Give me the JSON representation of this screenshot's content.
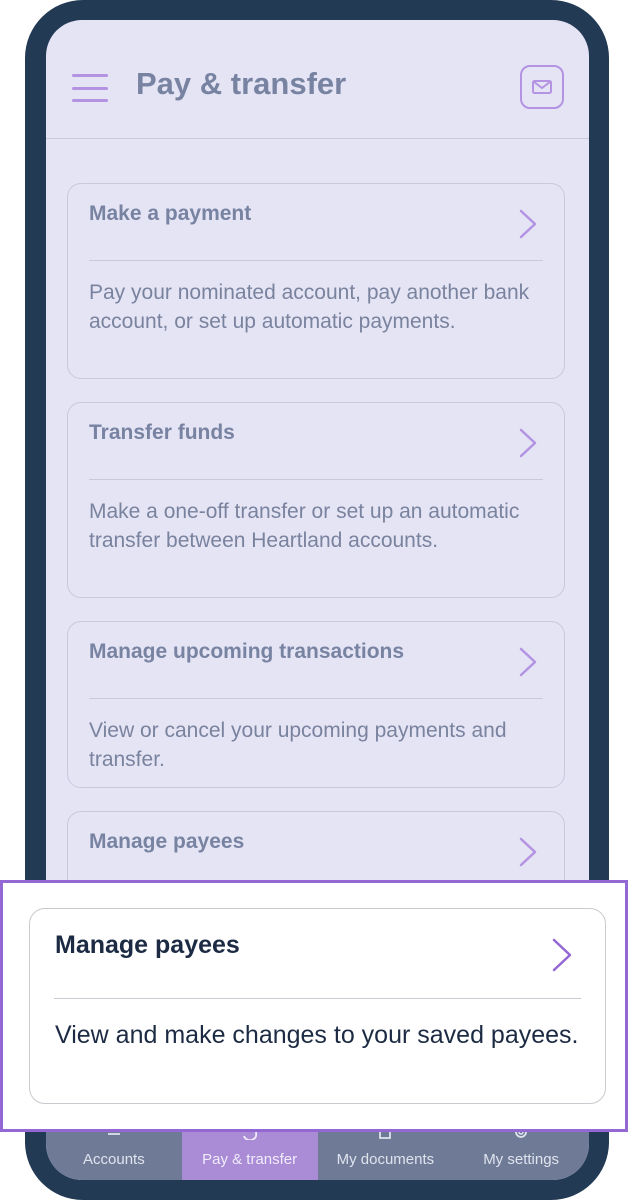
{
  "header": {
    "title": "Pay & transfer",
    "menu_icon": "hamburger-icon",
    "mail_icon": "mail-icon"
  },
  "cards": [
    {
      "title": "Make a payment",
      "description": "Pay your nominated account, pay another bank account, or set up automatic payments."
    },
    {
      "title": "Transfer funds",
      "description": "Make a one-off transfer or set up an automatic transfer between Heartland accounts."
    },
    {
      "title": "Manage upcoming transactions",
      "description": "View or cancel your upcoming payments and transfer."
    },
    {
      "title": "Manage payees"
    }
  ],
  "highlight": {
    "title": "Manage payees",
    "description": "View and make changes to your saved payees."
  },
  "nav": {
    "items": [
      {
        "label": "Accounts",
        "icon": "accounts-icon"
      },
      {
        "label": "Pay & transfer",
        "icon": "transfer-icon",
        "active": true
      },
      {
        "label": "My documents",
        "icon": "documents-icon"
      },
      {
        "label": "My settings",
        "icon": "settings-icon"
      }
    ]
  },
  "colors": {
    "accent": "#b493e2",
    "frame": "#233a55",
    "screen_bg": "#e4e4f5",
    "highlight_border": "#9468d4",
    "nav_active": "#a98bd6"
  }
}
